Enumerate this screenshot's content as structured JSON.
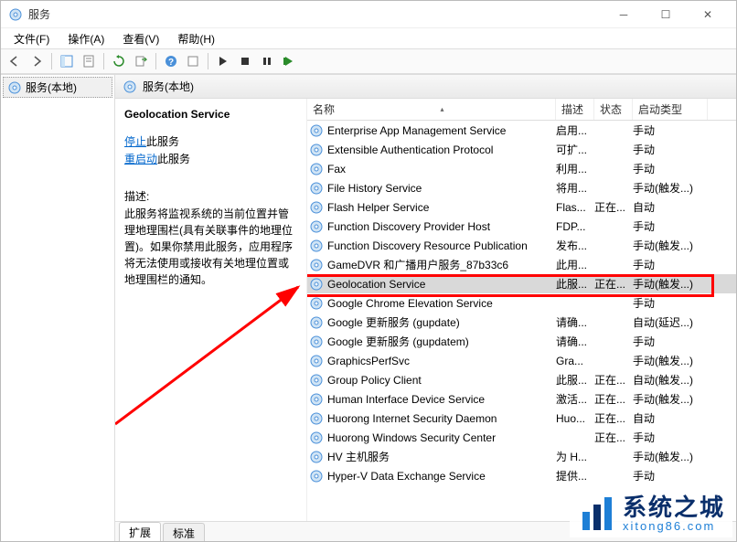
{
  "title": "服务",
  "menu": {
    "file": "文件(F)",
    "action": "操作(A)",
    "view": "查看(V)",
    "help": "帮助(H)"
  },
  "left_tree": {
    "root": "服务(本地)"
  },
  "right_header": {
    "title": "服务(本地)"
  },
  "detail": {
    "service_name": "Geolocation Service",
    "stop_label": "停止",
    "restart_label": "重启动",
    "this_service": "此服务",
    "desc_label": "描述:",
    "desc_text": "此服务将监视系统的当前位置并管理地理围栏(具有关联事件的地理位置)。如果你禁用此服务，应用程序将无法使用或接收有关地理位置或地理围栏的通知。"
  },
  "columns": {
    "name": "名称",
    "desc": "描述",
    "status": "状态",
    "start": "启动类型"
  },
  "services": [
    {
      "name": "Enterprise App Management Service",
      "desc": "启用...",
      "status": "",
      "start": "手动"
    },
    {
      "name": "Extensible Authentication Protocol",
      "desc": "可扩...",
      "status": "",
      "start": "手动"
    },
    {
      "name": "Fax",
      "desc": "利用...",
      "status": "",
      "start": "手动"
    },
    {
      "name": "File History Service",
      "desc": "将用...",
      "status": "",
      "start": "手动(触发...)"
    },
    {
      "name": "Flash Helper Service",
      "desc": "Flas...",
      "status": "正在...",
      "start": "自动"
    },
    {
      "name": "Function Discovery Provider Host",
      "desc": "FDP...",
      "status": "",
      "start": "手动"
    },
    {
      "name": "Function Discovery Resource Publication",
      "desc": "发布...",
      "status": "",
      "start": "手动(触发...)"
    },
    {
      "name": "GameDVR 和广播用户服务_87b33c6",
      "desc": "此用...",
      "status": "",
      "start": "手动"
    },
    {
      "name": "Geolocation Service",
      "desc": "此服...",
      "status": "正在...",
      "start": "手动(触发...)",
      "selected": true
    },
    {
      "name": "Google Chrome Elevation Service",
      "desc": "",
      "status": "",
      "start": "手动"
    },
    {
      "name": "Google 更新服务 (gupdate)",
      "desc": "请确...",
      "status": "",
      "start": "自动(延迟...)"
    },
    {
      "name": "Google 更新服务 (gupdatem)",
      "desc": "请确...",
      "status": "",
      "start": "手动"
    },
    {
      "name": "GraphicsPerfSvc",
      "desc": "Gra...",
      "status": "",
      "start": "手动(触发...)"
    },
    {
      "name": "Group Policy Client",
      "desc": "此服...",
      "status": "正在...",
      "start": "自动(触发...)"
    },
    {
      "name": "Human Interface Device Service",
      "desc": "激活...",
      "status": "正在...",
      "start": "手动(触发...)"
    },
    {
      "name": "Huorong Internet Security Daemon",
      "desc": "Huo...",
      "status": "正在...",
      "start": "自动"
    },
    {
      "name": "Huorong Windows Security Center",
      "desc": "",
      "status": "正在...",
      "start": "手动"
    },
    {
      "name": "HV 主机服务",
      "desc": "为 H...",
      "status": "",
      "start": "手动(触发...)"
    },
    {
      "name": "Hyper-V Data Exchange Service",
      "desc": "提供...",
      "status": "",
      "start": "手动"
    }
  ],
  "tabs": {
    "extended": "扩展",
    "standard": "标准"
  },
  "watermark": {
    "text": "系统之城",
    "url": "xitong86.com"
  }
}
